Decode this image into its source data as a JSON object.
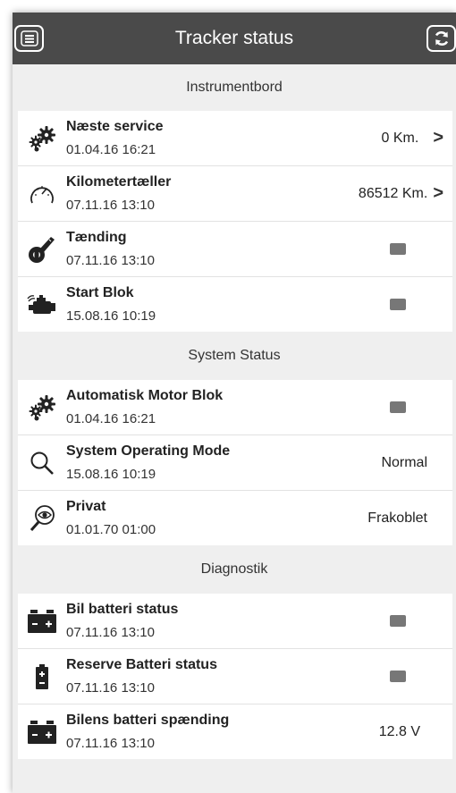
{
  "header": {
    "title": "Tracker status",
    "menu_icon": "menu-icon",
    "refresh_icon": "refresh-icon"
  },
  "sections": [
    {
      "title": "Instrumentbord"
    },
    {
      "title": "System Status"
    },
    {
      "title": "Diagnostik"
    }
  ],
  "instrumentbord": [
    {
      "title": "Næste service",
      "date": "01.04.16 16:21",
      "value": "0 Km.",
      "icon": "gears-icon"
    },
    {
      "title": "Kilometertæller",
      "date": "07.11.16 13:10",
      "value": "86512 Km.",
      "icon": "speedometer-icon"
    },
    {
      "title": "Tænding",
      "date": "07.11.16 13:10",
      "icon": "ignition-key-icon"
    },
    {
      "title": "Start Blok",
      "date": "15.08.16 10:19",
      "icon": "engine-icon"
    }
  ],
  "system_status": [
    {
      "title": "Automatisk Motor Blok",
      "date": "01.04.16 16:21",
      "icon": "gears-icon"
    },
    {
      "title": "System Operating Mode",
      "date": "15.08.16 10:19",
      "value": "Normal",
      "icon": "magnifier-icon"
    },
    {
      "title": "Privat",
      "date": "01.01.70 01:00",
      "value": "Frakoblet",
      "icon": "eye-magnifier-icon"
    }
  ],
  "diagnostik": [
    {
      "title": "Bil batteri status",
      "date": "07.11.16 13:10",
      "icon": "car-battery-icon"
    },
    {
      "title": "Reserve Batteri status",
      "date": "07.11.16 13:10",
      "icon": "backup-battery-icon"
    },
    {
      "title": "Bilens batteri spænding",
      "date": "07.11.16 13:10",
      "value": "12.8 V",
      "icon": "car-battery-icon"
    }
  ],
  "colors": {
    "header_bg": "#4a4a4a",
    "page_bg": "#efefef",
    "indicator": "#777777"
  }
}
